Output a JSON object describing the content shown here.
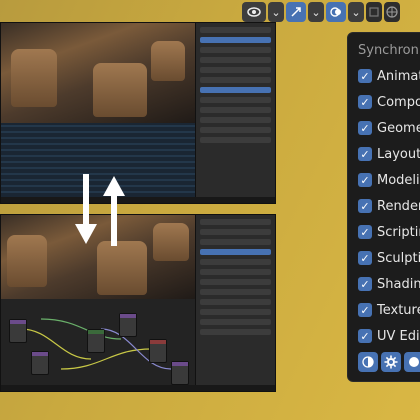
{
  "panel": {
    "title": "Synchronize",
    "items": [
      {
        "label": "Animation",
        "checked": true
      },
      {
        "label": "Compositing",
        "checked": true
      },
      {
        "label": "Geometry Nodes",
        "checked": true
      },
      {
        "label": "Layout",
        "checked": true
      },
      {
        "label": "Modeling",
        "checked": true
      },
      {
        "label": "Rendering",
        "checked": true
      },
      {
        "label": "Scripting",
        "checked": true
      },
      {
        "label": "Sculpting",
        "checked": true
      },
      {
        "label": "Shading",
        "checked": true
      },
      {
        "label": "Texture Paint",
        "checked": true
      },
      {
        "label": "UV Editing",
        "checked": true
      }
    ],
    "icons": [
      "shading-icon",
      "gear-icon",
      "sphere-icon"
    ]
  },
  "header": {
    "icons": [
      "eye-icon",
      "chevron-down-icon",
      "gizmo-icon",
      "chevron-down-icon",
      "overlay-icon",
      "chevron-down-icon",
      "xray-icon",
      "globe-icon"
    ]
  },
  "colors": {
    "accent": "#4772b3",
    "panel_bg": "#1c1c1c",
    "background": "#c9a93f"
  }
}
